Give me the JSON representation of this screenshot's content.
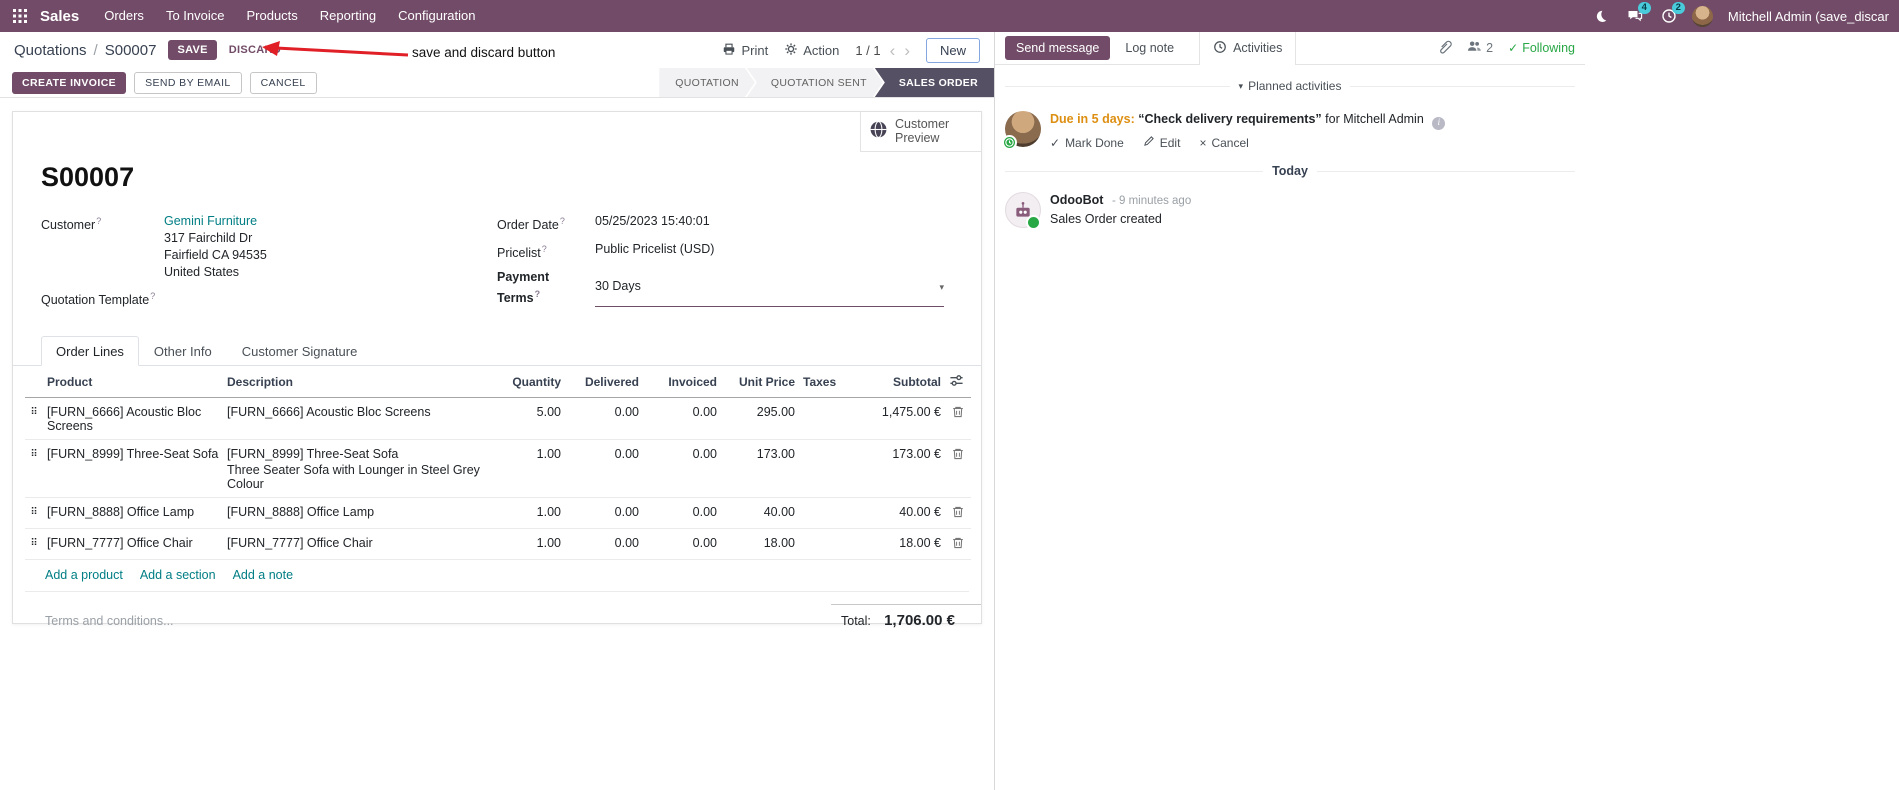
{
  "glyphs": {
    "caret_down": "▾",
    "drag": "⠿",
    "check": "✓",
    "times": "×",
    "info": "i"
  },
  "topbar": {
    "app_name": "Sales",
    "menus": [
      "Orders",
      "To Invoice",
      "Products",
      "Reporting",
      "Configuration"
    ],
    "messages_badge": "4",
    "activities_badge": "2",
    "user_name": "Mitchell Admin (save_discar"
  },
  "control": {
    "breadcrumb_parent": "Quotations",
    "breadcrumb_sep": "/",
    "breadcrumb_current": "S00007",
    "save": "SAVE",
    "discard": "DISCARD",
    "annotation": "save and discard button",
    "print": "Print",
    "action": "Action",
    "prev": "‹",
    "pager": "1 / 1",
    "next": "›",
    "new": "New"
  },
  "statusbar": {
    "create_invoice": "CREATE INVOICE",
    "send_by_email": "SEND BY EMAIL",
    "cancel": "CANCEL",
    "steps": [
      {
        "label": "QUOTATION"
      },
      {
        "label": "QUOTATION SENT"
      },
      {
        "label": "SALES ORDER"
      }
    ]
  },
  "sheet": {
    "customer_preview": "Customer Preview",
    "title": "S00007",
    "help_marker": "?",
    "customer": {
      "label": "Customer",
      "name": "Gemini Furniture",
      "address1": "317 Fairchild Dr",
      "address2": "Fairfield CA 94535",
      "address3": "United States"
    },
    "quotation_template_label": "Quotation Template",
    "order_date": {
      "label": "Order Date",
      "value": "05/25/2023 15:40:01"
    },
    "pricelist": {
      "label": "Pricelist",
      "value": "Public Pricelist (USD)"
    },
    "payment_terms": {
      "label": "Payment Terms",
      "value": "30 Days"
    },
    "tabs": {
      "order_lines": "Order Lines",
      "other_info": "Other Info",
      "customer_signature": "Customer Signature"
    },
    "table": {
      "headers": {
        "product": "Product",
        "description": "Description",
        "quantity": "Quantity",
        "delivered": "Delivered",
        "invoiced": "Invoiced",
        "unit_price": "Unit Price",
        "taxes": "Taxes",
        "subtotal": "Subtotal"
      },
      "rows": [
        {
          "product": "[FURN_6666] Acoustic Bloc Screens",
          "desc1": "[FURN_6666] Acoustic Bloc Screens",
          "qty": "5.00",
          "delivered": "0.00",
          "invoiced": "0.00",
          "price": "295.00",
          "subtotal": "1,475.00 €"
        },
        {
          "product": "[FURN_8999] Three-Seat Sofa",
          "desc1": "[FURN_8999] Three-Seat Sofa",
          "desc2": "Three Seater Sofa with Lounger in Steel Grey Colour",
          "qty": "1.00",
          "delivered": "0.00",
          "invoiced": "0.00",
          "price": "173.00",
          "subtotal": "173.00 €"
        },
        {
          "product": "[FURN_8888] Office Lamp",
          "desc1": "[FURN_8888] Office Lamp",
          "qty": "1.00",
          "delivered": "0.00",
          "invoiced": "0.00",
          "price": "40.00",
          "subtotal": "40.00 €"
        },
        {
          "product": "[FURN_7777] Office Chair",
          "desc1": "[FURN_7777] Office Chair",
          "qty": "1.00",
          "delivered": "0.00",
          "invoiced": "0.00",
          "price": "18.00",
          "subtotal": "18.00 €"
        }
      ],
      "add_product": "Add a product",
      "add_section": "Add a section",
      "add_note": "Add a note"
    },
    "terms_placeholder": "Terms and conditions...",
    "total_label": "Total:",
    "total_value": "1,706.00 €"
  },
  "chatter": {
    "send_message": "Send message",
    "log_note": "Log note",
    "activities": "Activities",
    "followers_count": "2",
    "following": "Following",
    "planned_header": "Planned activities",
    "activity": {
      "due": "Due in 5 days:",
      "summary": "“Check delivery requirements”",
      "for_user": "for Mitchell Admin",
      "mark_done": "Mark Done",
      "edit": "Edit",
      "cancel": "Cancel"
    },
    "today": "Today",
    "message": {
      "author": "OdooBot",
      "time": "- 9 minutes ago",
      "body": "Sales Order created"
    }
  }
}
